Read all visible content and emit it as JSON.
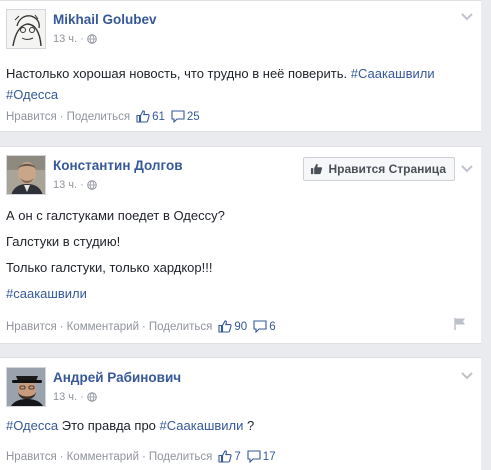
{
  "colors": {
    "link": "#365899",
    "meta": "#90949c",
    "text": "#1d2129",
    "background": "#e9ebee"
  },
  "posts": [
    {
      "author": "Mikhail Golubev",
      "time": "13 ч.",
      "text_lines": [
        {
          "plain": "Настолько хорошая новость, что трудно в неё поверить. ",
          "tag": "#Саакашвили"
        },
        {
          "plain": "",
          "tag": "#Одесса"
        }
      ],
      "actions": {
        "like": "Нравится",
        "share": "Поделиться"
      },
      "likes": "61",
      "comments": "25"
    },
    {
      "author": "Константин Долгов",
      "time": "13 ч.",
      "like_page_button": "Нравится Страница",
      "text_lines": [
        {
          "plain": "А он с галстуками поедет в Одессу?",
          "tag": ""
        },
        {
          "plain": "Галстуки в студию!",
          "tag": ""
        },
        {
          "plain": "Только галстуки, только хардкор!!!",
          "tag": ""
        },
        {
          "plain": "",
          "tag": "#саакашвили"
        }
      ],
      "actions": {
        "like": "Нравится",
        "comment": "Комментарий",
        "share": "Поделиться"
      },
      "likes": "90",
      "comments": "6"
    },
    {
      "author": "Андрей Рабинович",
      "time": "13 ч.",
      "text_parts": {
        "tag1": "#Одесса",
        "middle": " Это правда про ",
        "tag2": "#Саакашвили",
        "end": " ?"
      },
      "actions": {
        "like": "Нравится",
        "comment": "Комментарий",
        "share": "Поделиться"
      },
      "likes": "7",
      "comments": "17"
    }
  ],
  "icons": [
    "globe-icon",
    "chevron-down-icon",
    "thumbs-up-icon",
    "comment-icon",
    "flag-icon"
  ]
}
